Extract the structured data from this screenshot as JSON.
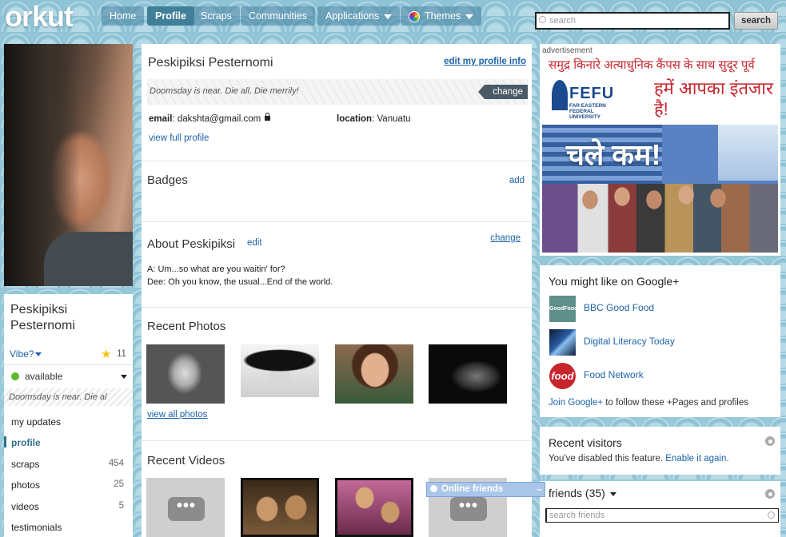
{
  "nav": {
    "logo": "orkut",
    "items": [
      {
        "label": "Home"
      },
      {
        "label": "Profile"
      },
      {
        "label": "Scraps"
      },
      {
        "label": "Communities"
      },
      {
        "label": "Applications"
      },
      {
        "label": "Themes"
      }
    ],
    "search_placeholder": "search",
    "search_button": "search"
  },
  "left": {
    "first_name": "Peskipiksi",
    "last_name": "Pesternomi",
    "vibe": "Vibe?",
    "stars": "11",
    "status": "available",
    "status_message": "Doomsday is near. Die al",
    "menu": [
      {
        "label": "my updates",
        "count": ""
      },
      {
        "label": "profile",
        "count": ""
      },
      {
        "label": "scraps",
        "count": "454"
      },
      {
        "label": "photos",
        "count": "25"
      },
      {
        "label": "videos",
        "count": "5"
      },
      {
        "label": "testimonials",
        "count": ""
      }
    ]
  },
  "main": {
    "name": "Peskipiksi Pesternomi",
    "edit_profile": "edit my profile info",
    "status_message": "Doomsday is near. Die all, Die merrily!",
    "change": "change",
    "email_label": "email",
    "email": "dakshta@gmail.com",
    "location_label": "location",
    "location": "Vanuatu",
    "view_full_profile": "view full profile",
    "badges_title": "Badges",
    "badges_add": "add",
    "about_title": "About Peskipiksi",
    "about_edit": "edit",
    "about_change": "change",
    "about_line1": "A: Um...so what are you waitin' for?",
    "about_line2": "Dee: Oh you know, the usual...End of the world.",
    "photos_title": "Recent Photos",
    "view_all_photos": "view all photos",
    "videos_title": "Recent Videos",
    "video_placeholder": "•••"
  },
  "ad": {
    "label": "advertisement",
    "top_strip": "समुद्र किनारे अत्याधुनिक कैंपस के साथ सुदूर पूर्व",
    "logo": "FEFU",
    "logo_sub": "FAR EASTERN FEDERAL UNIVERSITY",
    "headline": "हमें आपका इंतजार है!",
    "slogan": "चले कम!"
  },
  "google_plus": {
    "title": "You might like on Google+",
    "pages": [
      {
        "name": "BBC Good Food",
        "icon_text": "GoodFood"
      },
      {
        "name": "Digital Literacy Today",
        "icon_text": ""
      },
      {
        "name": "Food Network",
        "icon_text": "food"
      }
    ],
    "join_link": "Join Google+",
    "join_text": " to follow these +Pages and profiles"
  },
  "recent_visitors": {
    "title": "Recent visitors",
    "text": "You've disabled this feature. ",
    "enable_link": "Enable it again."
  },
  "friends": {
    "title": "friends (35)",
    "search_placeholder": "search friends"
  },
  "online_friends": {
    "label": "Online friends",
    "minimize": "–"
  }
}
